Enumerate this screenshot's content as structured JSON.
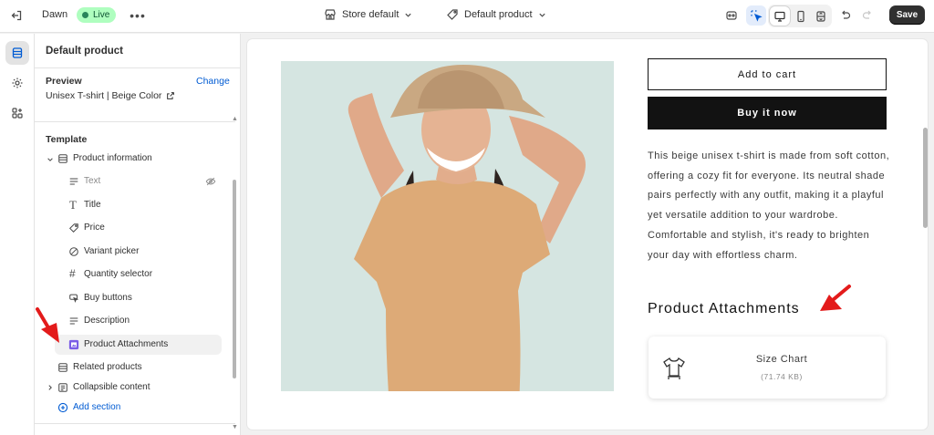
{
  "topbar": {
    "store_name": "Dawn",
    "status": "Live",
    "store_select": "Store default",
    "product_select": "Default product",
    "save_label": "Save"
  },
  "panel": {
    "title": "Default product",
    "preview_label": "Preview",
    "change_label": "Change",
    "preview_product": "Unisex T-shirt | Beige Color",
    "template_label": "Template",
    "section_product_info": "Product information",
    "blocks": [
      "Text",
      "Title",
      "Price",
      "Variant picker",
      "Quantity selector",
      "Buy buttons",
      "Description",
      "Product Attachments"
    ],
    "section_related": "Related products",
    "section_collapsible": "Collapsible content",
    "add_section": "Add section"
  },
  "preview": {
    "add_to_cart": "Add to cart",
    "buy_now": "Buy it now",
    "description": "This beige unisex t-shirt is made from soft cotton, offering a cozy fit for everyone. Its neutral shade pairs perfectly with any outfit, making it a playful yet versatile addition to your wardrobe. Comfortable and stylish, it's ready to brighten your day with effortless charm.",
    "attachments_heading": "Product Attachments",
    "attachment_name": "Size Chart",
    "attachment_size": "(71.74 KB)"
  },
  "colors": {
    "accent": "#005bd3",
    "live_badge": "#affebf",
    "live_dot": "#29845a",
    "annotation_arrow": "#e31b1b",
    "button_dark": "#121212"
  }
}
